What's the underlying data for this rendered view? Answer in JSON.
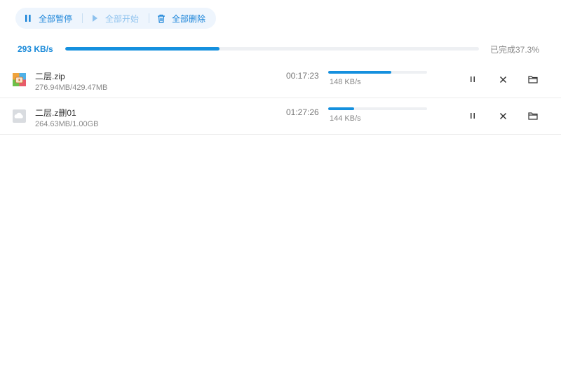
{
  "toolbar": {
    "pause_all_label": "全部暂停",
    "start_all_label": "全部开始",
    "delete_all_label": "全部删除"
  },
  "overall": {
    "speed": "293 KB/s",
    "progress_percent": 37.3,
    "status": "已完成37.3%"
  },
  "tasks": [
    {
      "name": "二层.zip",
      "size": "276.94MB/429.47MB",
      "remaining": "00:17:23",
      "rate": "148 KB/s",
      "progress_percent": 64,
      "icon": "zip-archive-icon"
    },
    {
      "name": "二层.z删01",
      "size": "264.63MB/1.00GB",
      "remaining": "01:27:26",
      "rate": "144 KB/s",
      "progress_percent": 26,
      "icon": "generic-file-icon"
    }
  ],
  "colors": {
    "accent": "#1590de",
    "toolbar_bg": "#eef5fd",
    "disabled": "#8ec2ee"
  }
}
